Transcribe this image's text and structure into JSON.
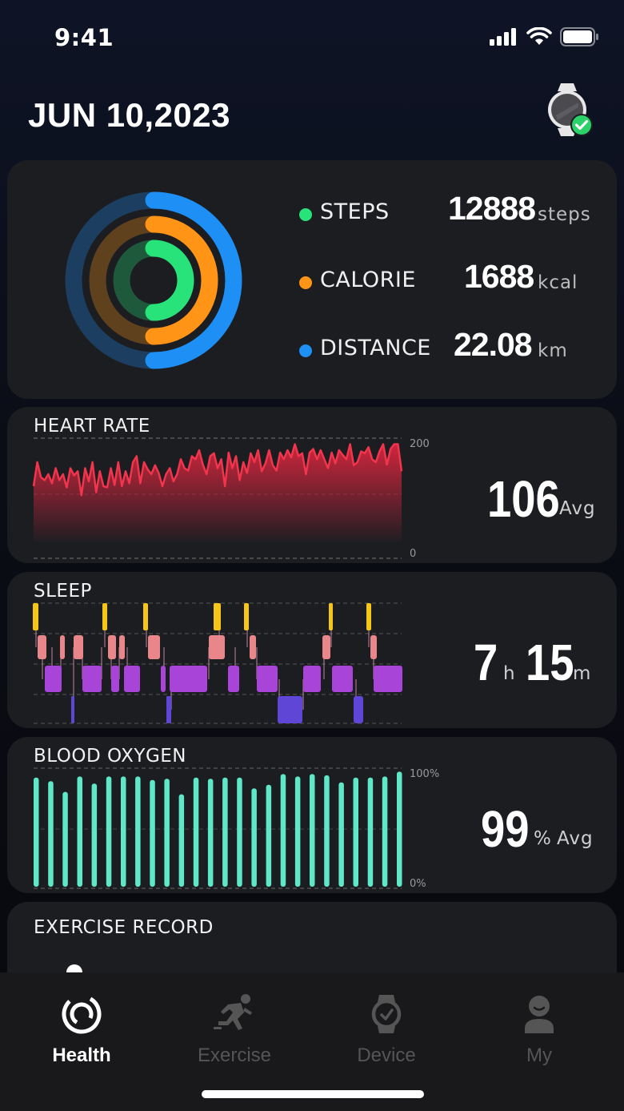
{
  "status": {
    "time": "9:41"
  },
  "header": {
    "date": "JUN 10,2023"
  },
  "activity": {
    "steps": {
      "label": "STEPS",
      "value": "12888",
      "unit": "steps",
      "color": "#27e37a",
      "progress": 0.5
    },
    "calorie": {
      "label": "CALORIE",
      "value": "1688",
      "unit": "kcal",
      "color": "#ff9416",
      "progress": 0.5
    },
    "distance": {
      "label": "DISTANCE",
      "value": "22.08",
      "unit": "km",
      "color": "#1e8ff5",
      "progress": 0.5
    }
  },
  "heart_rate": {
    "title": "HEART RATE",
    "value": "106",
    "unit": "Avg",
    "axis_max": "200",
    "axis_min": "0",
    "color": "#f2344c",
    "chart_data": {
      "type": "area",
      "ylim": [
        0,
        200
      ],
      "values": [
        120,
        160,
        135,
        130,
        140,
        125,
        150,
        130,
        140,
        118,
        150,
        138,
        145,
        105,
        150,
        128,
        160,
        110,
        145,
        120,
        118,
        150,
        122,
        160,
        120,
        145,
        125,
        160,
        170,
        125,
        160,
        148,
        140,
        155,
        142,
        120,
        140,
        150,
        128,
        140,
        165,
        150,
        146,
        170,
        165,
        180,
        156,
        140,
        170,
        175,
        150,
        165,
        120,
        176,
        150,
        170,
        130,
        160,
        142,
        175,
        160,
        180,
        145,
        158,
        180,
        155,
        146,
        176,
        165,
        180,
        168,
        190,
        170,
        175,
        140,
        176,
        182,
        165,
        180,
        165,
        150,
        176,
        158,
        180,
        172,
        165,
        190,
        155,
        160,
        178,
        175,
        185,
        165,
        160,
        178,
        190,
        156,
        182,
        190,
        190,
        145
      ]
    }
  },
  "sleep": {
    "title": "SLEEP",
    "hours": "7",
    "hours_unit": "h",
    "minutes": "15",
    "minutes_unit": "m",
    "colors": {
      "awake": "#f5c518",
      "rem": "#e8868a",
      "light": "#a844d8",
      "deep": "#6046d6"
    }
  },
  "blood_oxygen": {
    "title": "BLOOD OXYGEN",
    "value": "99",
    "unit_pct": "%",
    "unit_avg": "Avg",
    "axis_max": "100%",
    "axis_min": "0%",
    "color": "#5ee8c8",
    "chart_data": {
      "type": "bar",
      "ylim": [
        0,
        100
      ],
      "values": [
        92,
        89,
        80,
        93,
        87,
        93,
        93,
        93,
        90,
        91,
        78,
        92,
        91,
        92,
        92,
        83,
        86,
        95,
        93,
        95,
        94,
        88,
        92,
        92,
        93,
        97
      ]
    }
  },
  "exercise": {
    "title": "EXERCISE RECORD"
  },
  "tabs": [
    {
      "label": "Health",
      "active": true,
      "icon": "health-ring-icon"
    },
    {
      "label": "Exercise",
      "active": false,
      "icon": "runner-icon"
    },
    {
      "label": "Device",
      "active": false,
      "icon": "watch-icon"
    },
    {
      "label": "My",
      "active": false,
      "icon": "person-icon"
    }
  ]
}
